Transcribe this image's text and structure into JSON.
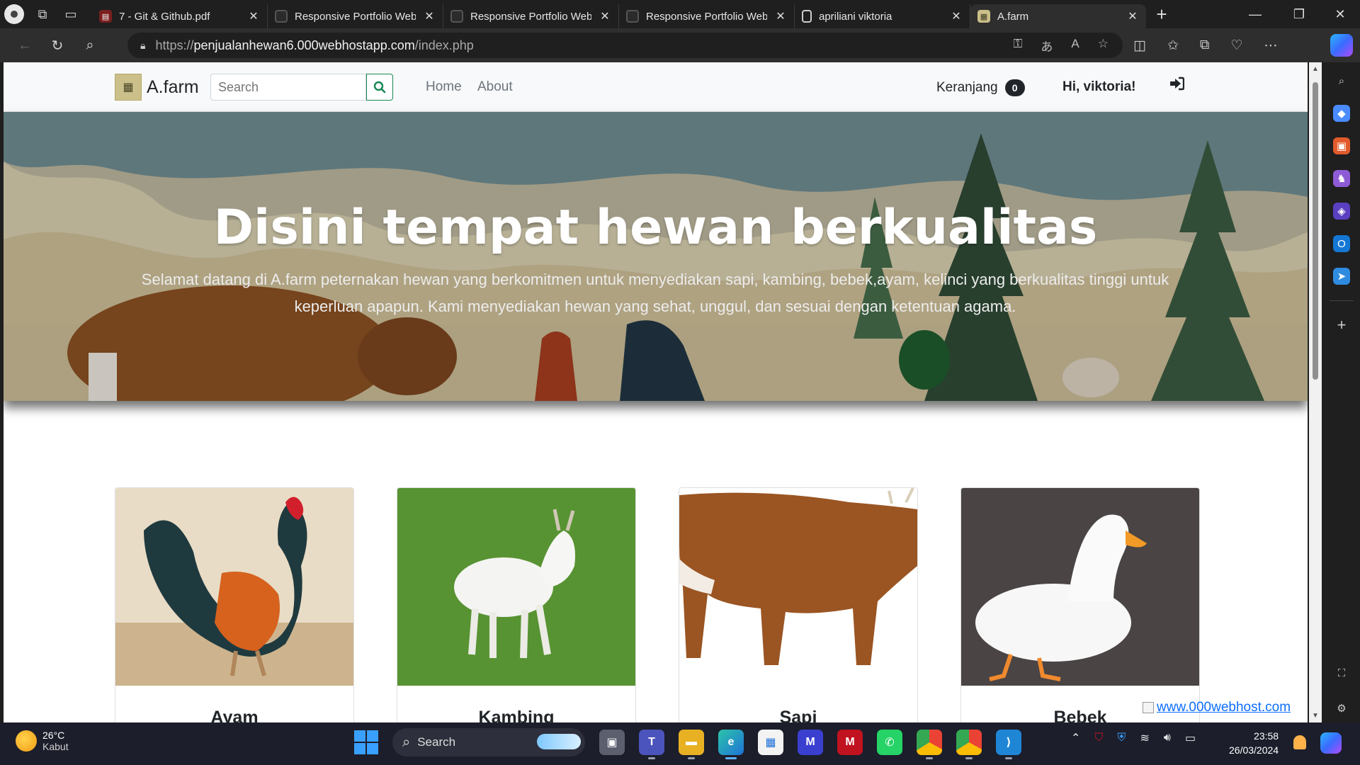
{
  "browser": {
    "tabs": [
      {
        "title": "7 - Git & Github.pdf",
        "favicon": "pdf-icon"
      },
      {
        "title": "Responsive Portfolio Web",
        "favicon": "web-icon"
      },
      {
        "title": "Responsive Portfolio Web",
        "favicon": "web-icon"
      },
      {
        "title": "Responsive Portfolio Web",
        "favicon": "web-icon"
      },
      {
        "title": "apriliani viktoria",
        "favicon": "document-icon"
      },
      {
        "title": "A.farm",
        "favicon": "farm-icon",
        "active": true
      }
    ],
    "url": {
      "scheme": "https://",
      "host": "penjualanhewan6.000webhostapp.com",
      "path": "/index.php"
    }
  },
  "site": {
    "brand": "A.farm",
    "search_placeholder": "Search",
    "nav": {
      "home": "Home",
      "about": "About"
    },
    "cart_label": "Keranjang",
    "cart_count": "0",
    "greeting": "Hi, viktoria!"
  },
  "hero": {
    "title": "Disini tempat hewan berkualitas",
    "subtitle": "Selamat datang di A.farm peternakan hewan yang berkomitmen untuk menyediakan sapi, kambing, bebek,ayam, kelinci yang berkualitas tinggi untuk keperluan apapun. Kami menyediakan hewan yang sehat, unggul, dan sesuai dengan ketentuan agama."
  },
  "products": [
    {
      "name": "Ayam"
    },
    {
      "name": "Kambing"
    },
    {
      "name": "Sapi"
    },
    {
      "name": "Bebek"
    }
  ],
  "host_link": "www.000webhost.com",
  "taskbar": {
    "weather_temp": "26°C",
    "weather_desc": "Kabut",
    "search_label": "Search",
    "time": "23:58",
    "date": "26/03/2024"
  },
  "colors": {
    "accent_green": "#198754",
    "browser_dark": "#1f1f1f",
    "taskbar": "#1c1e2b",
    "link_blue": "#0d6efd"
  }
}
